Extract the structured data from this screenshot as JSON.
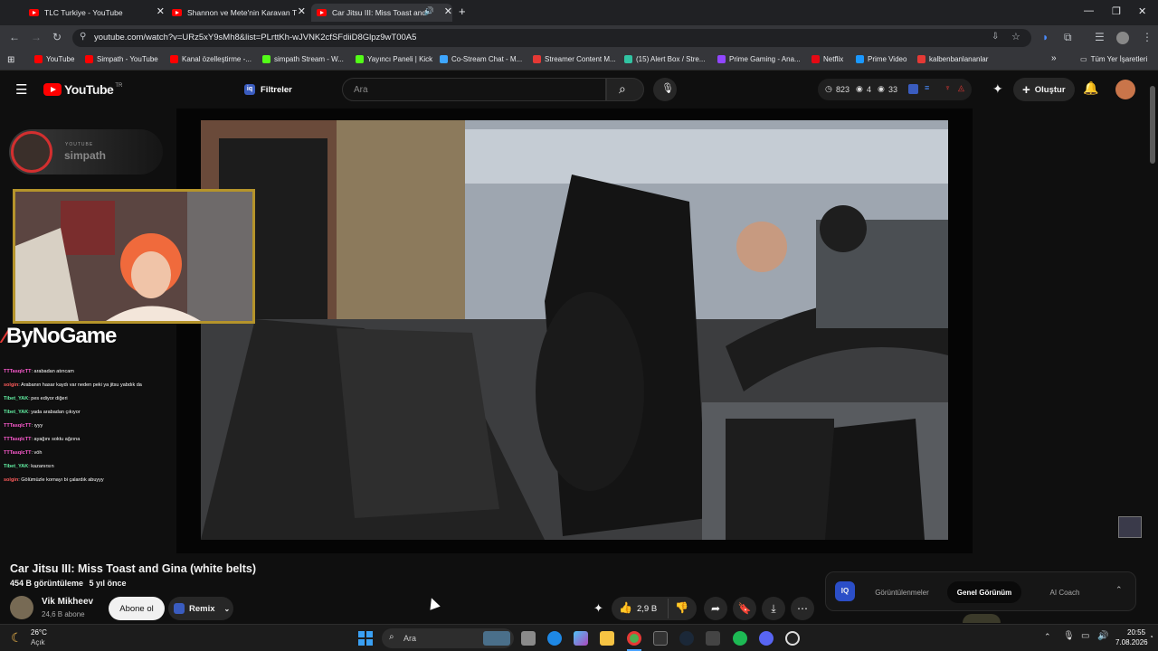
{
  "browser": {
    "tabs": [
      {
        "title": "TLC Turkiye - YouTube"
      },
      {
        "title": "Shannon ve Mete'nin Karavan T"
      },
      {
        "title": "Car Jitsu III: Miss Toast and"
      }
    ],
    "new_tab_label": "+",
    "url": "youtube.com/watch?v=URz5xY9sMh8&list=PLrttKh-wJVNK2cfSFdiiD8Glpz9wT00A5",
    "bookmarks": [
      {
        "label": "YouTube",
        "color": "#ff0000"
      },
      {
        "label": "Simpath - YouTube",
        "color": "#ff0000"
      },
      {
        "label": "Kanal özelleştirme -...",
        "color": "#ff0000"
      },
      {
        "label": "simpath Stream - W...",
        "color": "#53fc18"
      },
      {
        "label": "Yayıncı Paneli | Kick",
        "color": "#53fc18"
      },
      {
        "label": "Co-Stream Chat - M...",
        "color": "#3ea6ff"
      },
      {
        "label": "Streamer Content M...",
        "color": "#e53935"
      },
      {
        "label": "(15) Alert Box / Stre...",
        "color": "#31c3a2"
      },
      {
        "label": "Prime Gaming - Ana...",
        "color": "#9146ff"
      },
      {
        "label": "Netflix",
        "color": "#e50914"
      },
      {
        "label": "Prime Video",
        "color": "#1a98ff"
      },
      {
        "label": "kalbenbanlananlar",
        "color": "#e53935"
      }
    ],
    "all_bookmarks": "Tüm Yer İşaretleri"
  },
  "youtube": {
    "logo_text": "YouTube",
    "logo_country": "TR",
    "filters_label": "Filtreler",
    "search_placeholder": "Ara",
    "stats": {
      "clock": "823",
      "eye": "4",
      "views": "33"
    },
    "create_label": "Oluştur"
  },
  "stream_overlay": {
    "channel_brand": "YOUTUBE",
    "channel_name": "simpath",
    "sponsor": "ByNoGame",
    "chat": [
      {
        "user": "TTTasqlcTT",
        "user_color": "#ff5bd1",
        "text": ": arabadan atıncam"
      },
      {
        "user": "solgin",
        "user_color": "#ff5b5b",
        "text": ": Arabanın hasar kaydı var neden peki ya jitsu yabdık da"
      },
      {
        "user": "Tibet_YAK",
        "user_color": "#62f0a3",
        "text": ": pes ediyor diğeri"
      },
      {
        "user": "Tibet_YAK",
        "user_color": "#62f0a3",
        "text": ": yada arabadan çıkıyor"
      },
      {
        "user": "TTTasqlcTT",
        "user_color": "#ff5bd1",
        "text": ": ıyyy"
      },
      {
        "user": "TTTasqlcTT",
        "user_color": "#ff5bd1",
        "text": ": ayağını soktu ağzına"
      },
      {
        "user": "TTTasqlcTT",
        "user_color": "#ff5bd1",
        "text": ": vöh"
      },
      {
        "user": "Tibet_YAK",
        "user_color": "#62f0a3",
        "text": ": kazanırsın"
      },
      {
        "user": "solgin",
        "user_color": "#ff5b5b",
        "text": ": Gölümüzle kornayı bi çalardık abuyyy"
      }
    ]
  },
  "video": {
    "title": "Car Jitsu III: Miss Toast and Gina (white belts)",
    "views": "454 B görüntüleme",
    "age": "5 yıl önce",
    "owner": "Vik Mikheev",
    "subscribers": "24,6 B abone",
    "subscribe_label": "Abone ol",
    "remix_label": "Remix",
    "likes": "2,9 B"
  },
  "insights": {
    "badge": "IQ",
    "tabs": [
      "Görüntülenmeler",
      "Genel Görünüm",
      "AI Coach"
    ],
    "active_tab": 1
  },
  "taskbar": {
    "weather_temp": "26°C",
    "weather_desc": "Açık",
    "search_placeholder": "Ara",
    "time": "20:55",
    "date": "7.08.2026"
  }
}
